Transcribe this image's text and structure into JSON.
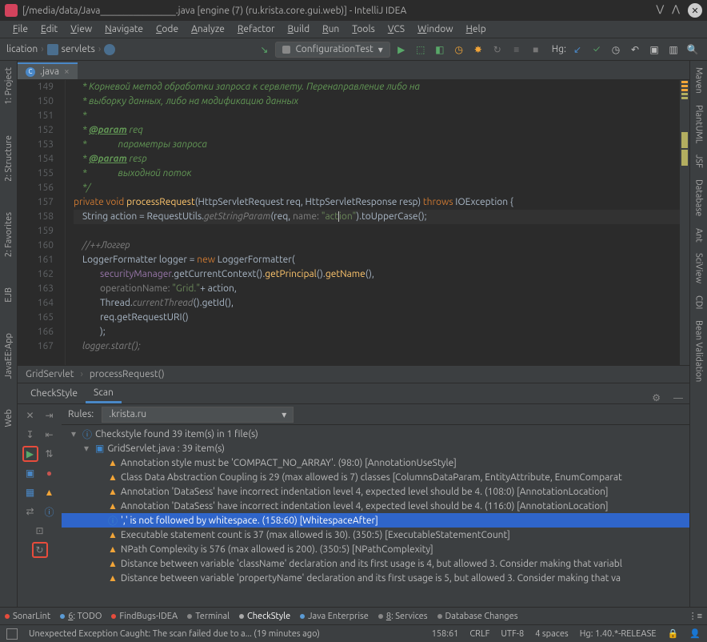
{
  "window": {
    "title_full": "[/media/data/Java________________.java [engine (7) (ru.krista.core.gui.web)] - IntelliJ IDEA"
  },
  "menu": [
    "File",
    "Edit",
    "View",
    "Navigate",
    "Code",
    "Analyze",
    "Refactor",
    "Build",
    "Run",
    "Tools",
    "VCS",
    "Window",
    "Help"
  ],
  "breadcrumb": {
    "item1": "lication",
    "item2": "servlets"
  },
  "run_config": "ConfigurationTest",
  "hg_label": "Hg:",
  "editor_tab": {
    "filename": ".java"
  },
  "gutter_lines": [
    "149",
    "150",
    "151",
    "152",
    "153",
    "154",
    "155",
    "156",
    "157",
    "158",
    "159",
    "160",
    "161",
    "162",
    "163",
    "164",
    "165",
    "166",
    "167"
  ],
  "code_crumb": {
    "c1": "GridServlet",
    "c2": "processRequest()"
  },
  "left_tabs": [
    "1: Project",
    "2: Structure",
    "2: Favorites",
    "EJB",
    "JavaEE:App",
    "Web"
  ],
  "right_tabs": [
    "Maven",
    "PlantUML",
    "JSF",
    "Database",
    "Ant",
    "SciView",
    "CDI",
    "Bean Validation"
  ],
  "tool": {
    "tab1": "CheckStyle",
    "tab2": "Scan",
    "rules_label": "Rules:",
    "rules_value": ".krista.ru",
    "root": "Checkstyle found 39 item(s) in 1 file(s)",
    "file": "GridServlet.java : 39 item(s)",
    "items": [
      {
        "t": "w",
        "txt": "Annotation style must be 'COMPACT_NO_ARRAY'. (98:0) [AnnotationUseStyle]"
      },
      {
        "t": "w",
        "txt": "Class Data Abstraction Coupling is 29 (max allowed is 7) classes [ColumnsDataParam, EntityAttribute, EnumComparat"
      },
      {
        "t": "w",
        "txt": "Annotation 'DataSess' have incorrect indentation level 4, expected level should be 4. (108:0) [AnnotationLocation]"
      },
      {
        "t": "w",
        "txt": "Annotation 'DataSess' have incorrect indentation level 4, expected level should be 4. (116:0) [AnnotationLocation]"
      },
      {
        "t": "i",
        "txt": "',' is not followed by whitespace. (158:60) [WhitespaceAfter]",
        "sel": true
      },
      {
        "t": "w",
        "txt": "Executable statement count is 37 (max allowed is 30). (350:5) [ExecutableStatementCount]"
      },
      {
        "t": "w",
        "txt": "NPath Complexity is 576 (max allowed is 200). (350:5) [NPathComplexity]"
      },
      {
        "t": "w",
        "txt": "Distance between variable 'className' declaration and its first usage is 4, but allowed 3.  Consider making that variabl"
      },
      {
        "t": "w",
        "txt": "Distance between variable 'propertyName' declaration and its first usage is 5, but allowed 3.  Consider making that va"
      }
    ]
  },
  "bottom_tabs": [
    {
      "label": "SonarLint",
      "color": "#e74c3c"
    },
    {
      "label": "6: TODO",
      "color": "#5b9bd5",
      "u": "6"
    },
    {
      "label": "FindBugs-IDEA",
      "color": "#e74c3c"
    },
    {
      "label": "Terminal",
      "color": "#888"
    },
    {
      "label": "CheckStyle",
      "color": "#aaa",
      "active": true
    },
    {
      "label": "Java Enterprise",
      "color": "#5b9bd5"
    },
    {
      "label": "8: Services",
      "color": "#888",
      "u": "8"
    },
    {
      "label": "Database Changes",
      "color": "#888"
    }
  ],
  "status": {
    "msg": "Unexpected Exception Caught: The scan failed due to a... (19 minutes ago)",
    "pos": "158:61",
    "lineend": "CRLF",
    "enc": "UTF-8",
    "indent": "4 spaces",
    "hg": "Hg: 1.40.*-RELEASE"
  }
}
